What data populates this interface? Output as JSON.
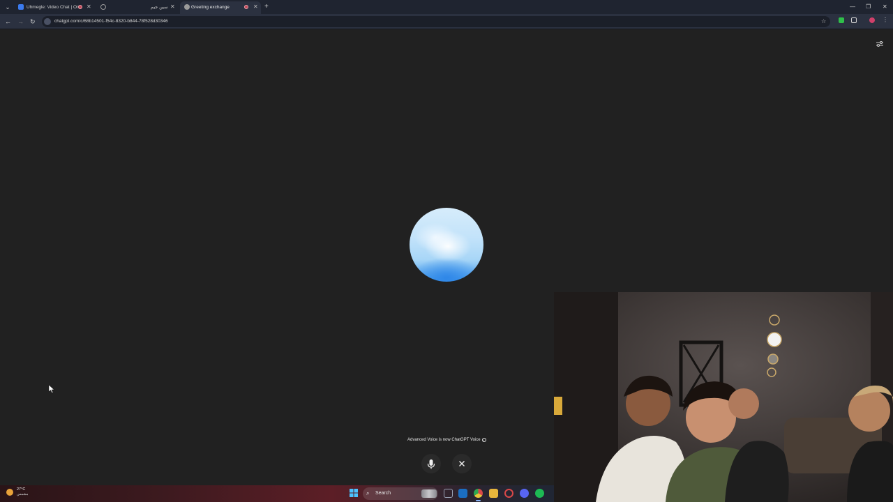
{
  "browser": {
    "tabs": [
      {
        "title": "Uhmegle: Video Chat | Om",
        "favicon_color": "#3b7bf0",
        "recording": true,
        "active": false
      },
      {
        "title": "",
        "favicon_color": "#9a9a9a",
        "recording": false,
        "active": false
      },
      {
        "title": "سين جيم",
        "favicon_color": "#9a9a9a",
        "recording": false,
        "active": false
      },
      {
        "title": "Greeting exchange",
        "favicon_color": "#9a9a9a",
        "recording": true,
        "active": true
      }
    ],
    "new_tab_label": "+",
    "window_controls": {
      "minimize": "—",
      "restore": "❐",
      "close": "✕"
    },
    "url": "chatgpt.com/c/68b14501-f54c-8320-b844-78f528d30346"
  },
  "page": {
    "voice_notice": "Advanced Voice is now ChatGPT Voice",
    "mic_icon": "mic-icon",
    "close_icon": "close-icon"
  },
  "taskbar": {
    "weather_temp": "27°C",
    "weather_desc": "مشمس",
    "search_label": "Search",
    "apps": [
      {
        "name": "task-view",
        "color": "#9aa3b5"
      },
      {
        "name": "outlook",
        "color": "#1b6ec2"
      },
      {
        "name": "chrome",
        "color": "#e8c63a",
        "active": true
      },
      {
        "name": "file-explorer",
        "color": "#e7b53c"
      },
      {
        "name": "chrome-dev",
        "color": "#d94848"
      },
      {
        "name": "discord",
        "color": "#5865f2"
      },
      {
        "name": "spotify",
        "color": "#1db954"
      }
    ]
  },
  "colors": {
    "accent": "#3a96ec",
    "background": "#212121"
  }
}
